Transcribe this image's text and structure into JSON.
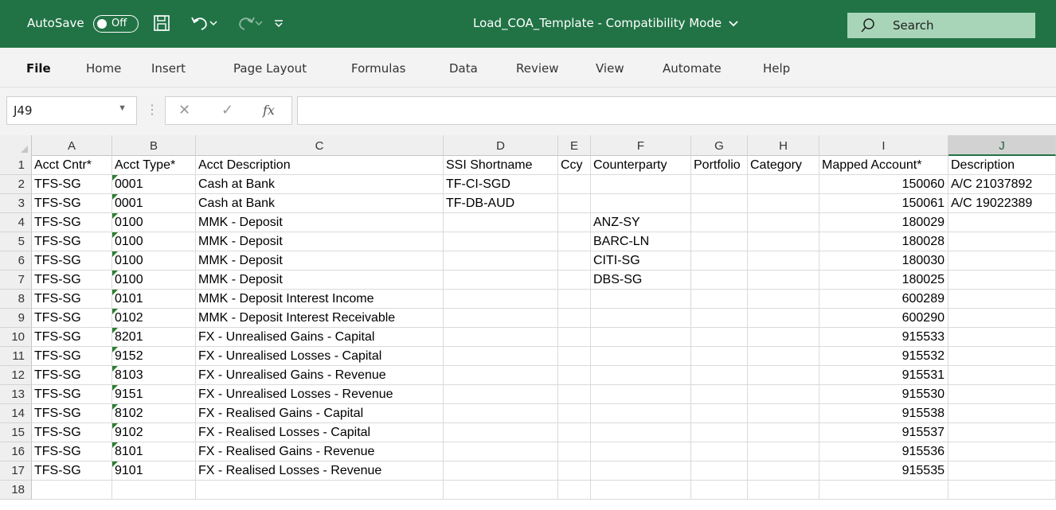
{
  "titlebar": {
    "autosave_label": "AutoSave",
    "toggle_state": "Off",
    "document_title": "Load_COA_Template  -  Compatibility Mode",
    "search_placeholder": "Search",
    "bg_color": "#217346"
  },
  "ribbon": {
    "tabs": [
      "File",
      "Home",
      "Insert",
      "Page Layout",
      "Formulas",
      "Data",
      "Review",
      "View",
      "Automate",
      "Help"
    ],
    "active_tab": "File"
  },
  "formula_bar": {
    "name_box": "J49",
    "formula": ""
  },
  "grid": {
    "selected_column": "J",
    "columns": [
      "A",
      "B",
      "C",
      "D",
      "E",
      "F",
      "G",
      "H",
      "I",
      "J"
    ],
    "row_numbers": [
      "1",
      "2",
      "3",
      "4",
      "5",
      "6",
      "7",
      "8",
      "9",
      "10",
      "11",
      "12",
      "13",
      "14",
      "15",
      "16",
      "17",
      "18"
    ],
    "header_row": [
      "Acct Cntr*",
      "Acct Type*",
      "Acct Description",
      "SSI Shortname",
      "Ccy",
      "Counterparty",
      "Portfolio",
      "Category",
      "Mapped Account*",
      "Description"
    ],
    "rows": [
      [
        "TFS-SG",
        "0001",
        "Cash at Bank",
        "TF-CI-SGD",
        "",
        "",
        "",
        "",
        "150060",
        "A/C 21037892"
      ],
      [
        "TFS-SG",
        "0001",
        "Cash at Bank",
        "TF-DB-AUD",
        "",
        "",
        "",
        "",
        "150061",
        "A/C 19022389"
      ],
      [
        "TFS-SG",
        "0100",
        "MMK - Deposit",
        "",
        "",
        "ANZ-SY",
        "",
        "",
        "180029",
        ""
      ],
      [
        "TFS-SG",
        "0100",
        "MMK - Deposit",
        "",
        "",
        "BARC-LN",
        "",
        "",
        "180028",
        ""
      ],
      [
        "TFS-SG",
        "0100",
        "MMK - Deposit",
        "",
        "",
        "CITI-SG",
        "",
        "",
        "180030",
        ""
      ],
      [
        "TFS-SG",
        "0100",
        "MMK - Deposit",
        "",
        "",
        "DBS-SG",
        "",
        "",
        "180025",
        ""
      ],
      [
        "TFS-SG",
        "0101",
        "MMK - Deposit Interest Income",
        "",
        "",
        "",
        "",
        "",
        "600289",
        ""
      ],
      [
        "TFS-SG",
        "0102",
        "MMK - Deposit Interest Receivable",
        "",
        "",
        "",
        "",
        "",
        "600290",
        ""
      ],
      [
        "TFS-SG",
        "8201",
        "FX - Unrealised Gains - Capital",
        "",
        "",
        "",
        "",
        "",
        "915533",
        ""
      ],
      [
        "TFS-SG",
        "9152",
        "FX - Unrealised Losses - Capital",
        "",
        "",
        "",
        "",
        "",
        "915532",
        ""
      ],
      [
        "TFS-SG",
        "8103",
        "FX - Unrealised Gains - Revenue",
        "",
        "",
        "",
        "",
        "",
        "915531",
        ""
      ],
      [
        "TFS-SG",
        "9151",
        "FX - Unrealised Losses - Revenue",
        "",
        "",
        "",
        "",
        "",
        "915530",
        ""
      ],
      [
        "TFS-SG",
        "8102",
        "FX - Realised Gains - Capital",
        "",
        "",
        "",
        "",
        "",
        "915538",
        ""
      ],
      [
        "TFS-SG",
        "9102",
        "FX - Realised Losses - Capital",
        "",
        "",
        "",
        "",
        "",
        "915537",
        ""
      ],
      [
        "TFS-SG",
        "8101",
        "FX - Realised Gains - Revenue",
        "",
        "",
        "",
        "",
        "",
        "915536",
        ""
      ],
      [
        "TFS-SG",
        "9101",
        "FX - Realised Losses - Revenue",
        "",
        "",
        "",
        "",
        "",
        "915535",
        ""
      ],
      [
        "",
        "",
        "",
        "",
        "",
        "",
        "",
        "",
        "",
        ""
      ]
    ]
  }
}
